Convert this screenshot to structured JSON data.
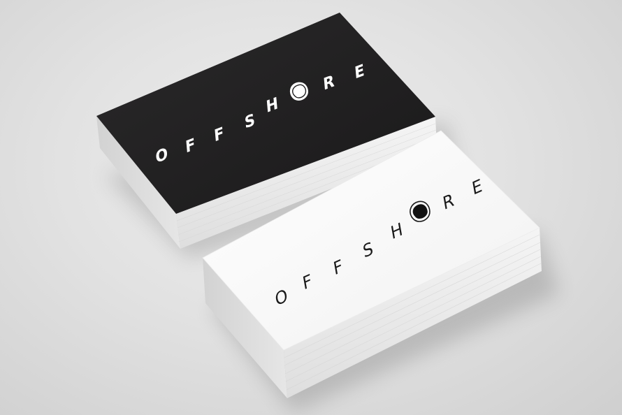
{
  "scene": {
    "background": "#e3e3e3",
    "subject": "business-card-mockup"
  },
  "brand": {
    "wordmark_letters": [
      "O",
      "F",
      "F",
      "S",
      "H",
      "R",
      "E"
    ],
    "logo_icon": "pebble-ring-icon"
  },
  "cards": [
    {
      "id": "black-card",
      "face_color": "#201f20",
      "text_color": "#ffffff",
      "edge_color": "#f2f2f2"
    },
    {
      "id": "white-card",
      "face_color": "#fafafa",
      "text_color": "#1a1a1a",
      "edge_color": "#e9e9e9"
    }
  ]
}
